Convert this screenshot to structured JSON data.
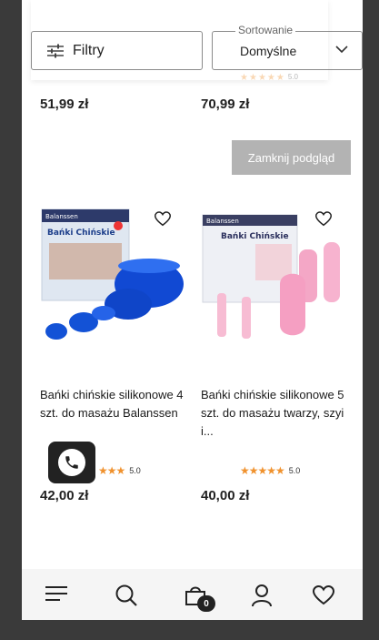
{
  "filters": {
    "filter_label": "Filtry",
    "sort_legend": "Sortowanie",
    "sort_value": "Domyślne"
  },
  "top_row": {
    "left_price": "51,99 zł",
    "right_price": "70,99 zł",
    "right_rating": "5.0"
  },
  "close_preview_label": "Zamknij podgląd",
  "products": [
    {
      "title": "Bańki chińskie silikonowe 4 szt. do masażu Balanssen",
      "rating": "5.0",
      "price": "42,00 zł",
      "image_colors": {
        "box": "#e0e8f2",
        "cups": "#1050d0"
      },
      "brand": "Balanssen",
      "box_text": "Bańki Chińskie"
    },
    {
      "title": "Bańki chińskie silikonowe 5 szt. do masażu twarzy, szyi i...",
      "rating": "5.0",
      "price": "40,00 zł",
      "image_colors": {
        "box": "#eef0f4",
        "cups": "#f5a9c9"
      },
      "brand": "Balanssen",
      "box_text": "Bańki Chińskie"
    }
  ],
  "bottom_nav": {
    "items": [
      "menu-icon",
      "search-icon",
      "cart-icon",
      "user-icon",
      "heart-icon"
    ],
    "cart_count": "0"
  },
  "colors": {
    "accent_star": "#f0922e",
    "close_preview_bg": "#b3b3b3",
    "call_btn_bg": "#222222"
  }
}
